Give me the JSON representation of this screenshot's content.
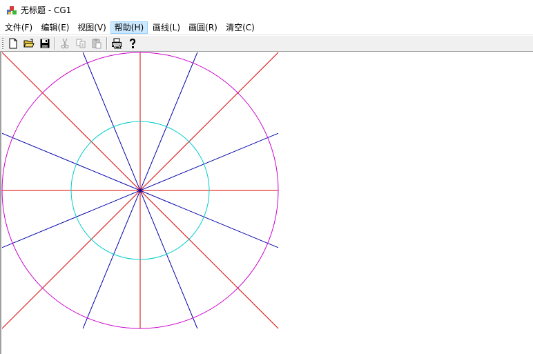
{
  "window": {
    "title": "无标题 - CG1"
  },
  "menu": {
    "items": [
      {
        "label": "文件(F)"
      },
      {
        "label": "编辑(E)"
      },
      {
        "label": "视图(V)"
      },
      {
        "label": "帮助(H)"
      },
      {
        "label": "画线(L)"
      },
      {
        "label": "画圆(R)"
      },
      {
        "label": "清空(C)"
      }
    ],
    "highlighted": "帮助(H)"
  },
  "toolbar": {
    "buttons": [
      {
        "icon": "new-document-icon",
        "enabled": true
      },
      {
        "icon": "open-folder-icon",
        "enabled": true
      },
      {
        "icon": "save-disk-icon",
        "enabled": true
      },
      {
        "icon": "cut-scissors-icon",
        "enabled": false
      },
      {
        "icon": "copy-icon",
        "enabled": false
      },
      {
        "icon": "paste-clipboard-icon",
        "enabled": false
      },
      {
        "icon": "print-icon",
        "enabled": true
      },
      {
        "icon": "help-question-icon",
        "enabled": true
      }
    ]
  },
  "drawing": {
    "colors": {
      "red_lines": "#dd0000",
      "blue_lines": "#0000aa",
      "outer_circle": "#cc00cc",
      "inner_circle": "#00cccc"
    },
    "outer_circle_radius": 200,
    "inner_circle_radius": 100,
    "red_line_angles_deg": [
      0,
      45,
      90,
      135
    ],
    "blue_line_angles_deg": [
      22.5,
      67.5,
      112.5,
      157.5
    ]
  }
}
